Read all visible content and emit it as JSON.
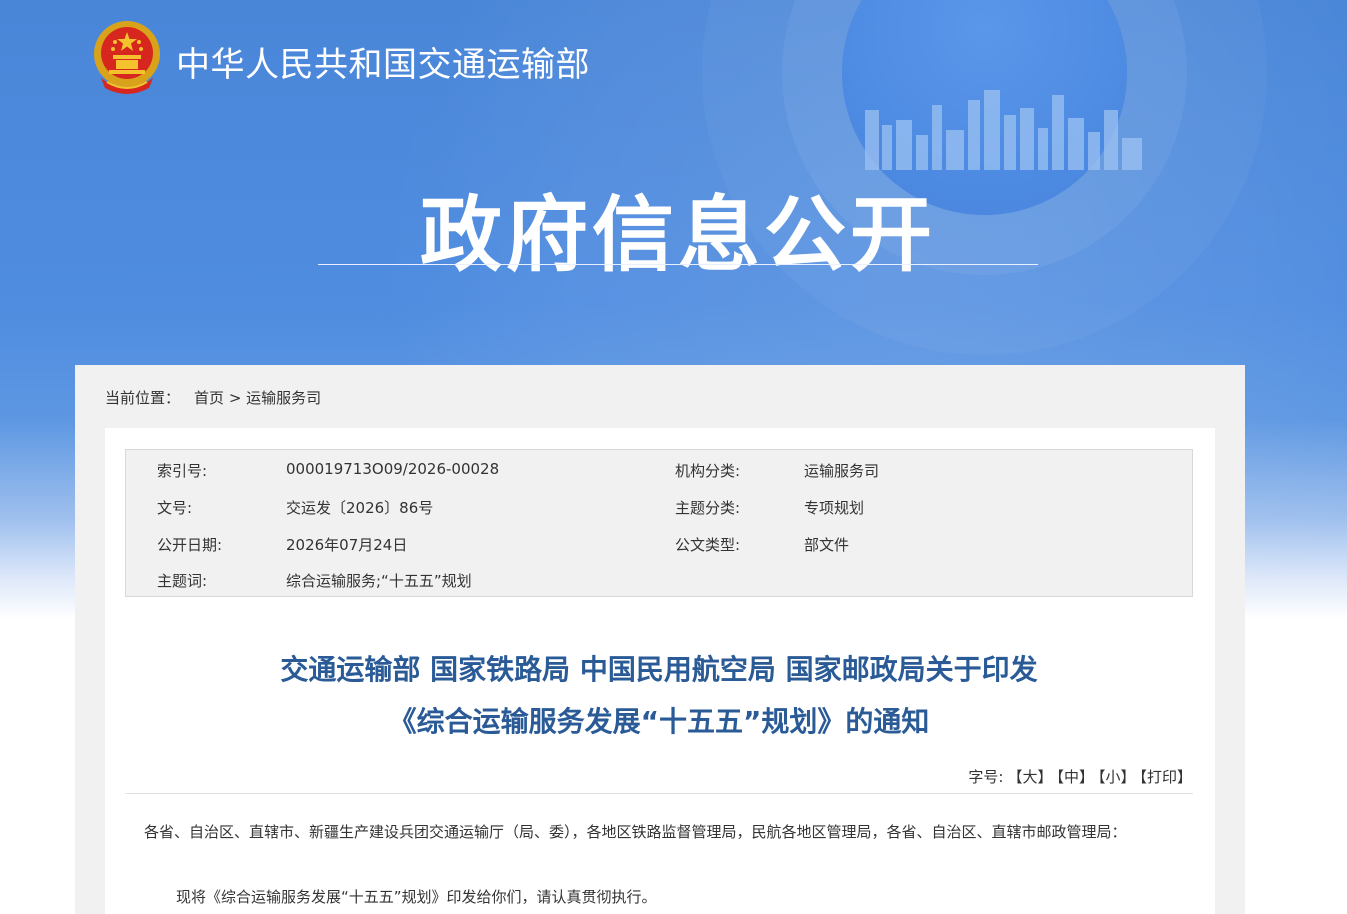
{
  "header": {
    "ministry_name": "中华人民共和国交通运输部",
    "section_title": "政府信息公开",
    "colors": {
      "banner": "#4a86d8",
      "title_blue": "#2a5b97"
    }
  },
  "breadcrumb": {
    "prefix": "当前位置：",
    "home": "首页",
    "separator": ">",
    "current": "运输服务司"
  },
  "meta": {
    "index_label": "索引号:",
    "index_value": "000019713O09/2026-00028",
    "org_label": "机构分类:",
    "org_value": "运输服务司",
    "doc_no_label": "文号:",
    "doc_no_value": "交运发〔2026〕86号",
    "topic_label": "主题分类:",
    "topic_value": "专项规划",
    "date_label": "公开日期:",
    "date_value": "2026年07月24日",
    "type_label": "公文类型:",
    "type_value": "部文件",
    "keywords_label": "主题词:",
    "keywords_value": "综合运输服务;“十五五”规划"
  },
  "document": {
    "title_line1": "交通运输部 国家铁路局 中国民用航空局 国家邮政局关于印发",
    "title_line2": "《综合运输服务发展“十五五”规划》的通知",
    "font_size_label": "字号:",
    "font_large": "【大】",
    "font_medium": "【中】",
    "font_small": "【小】",
    "print": "【打印】",
    "paragraph1": "各省、自治区、直辖市、新疆生产建设兵团交通运输厅（局、委），各地区铁路监督管理局，民航各地区管理局，各省、自治区、直辖市邮政管理局：",
    "paragraph2": "现将《综合运输服务发展“十五五”规划》印发给你们，请认真贯彻执行。"
  }
}
